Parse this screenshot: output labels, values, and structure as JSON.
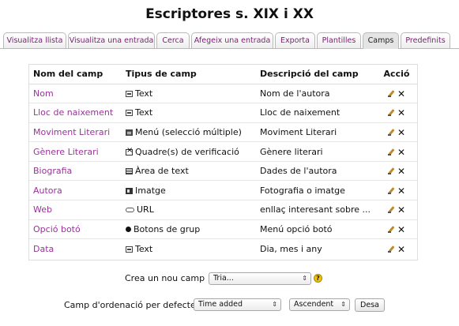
{
  "page": {
    "title": "Escriptores s. XIX i XX"
  },
  "tabs": [
    {
      "label": "Visualitza llista",
      "active": false
    },
    {
      "label": "Visualitza una entrada",
      "active": false
    },
    {
      "label": "Cerca",
      "active": false
    },
    {
      "label": "Afegeix una entrada",
      "active": false
    },
    {
      "label": "Exporta",
      "active": false
    },
    {
      "label": "Plantilles",
      "active": false
    },
    {
      "label": "Camps",
      "active": true
    },
    {
      "label": "Predefinits",
      "active": false
    }
  ],
  "table": {
    "headers": {
      "name": "Nom del camp",
      "type": "Tipus de camp",
      "desc": "Descripció del camp",
      "action": "Acció"
    },
    "rows": [
      {
        "name": "Nom",
        "type": "Text",
        "type_icon": "text-icon",
        "desc": "Nom de l'autora"
      },
      {
        "name": "Lloc de naixement",
        "type": "Text",
        "type_icon": "text-icon",
        "desc": "Lloc de naixement"
      },
      {
        "name": "Moviment Literari",
        "type": "Menú (selecció múltiple)",
        "type_icon": "menu-icon",
        "desc": "Moviment Literari"
      },
      {
        "name": "Gènere Literari",
        "type": "Quadre(s) de verificació",
        "type_icon": "checkbox-icon",
        "desc": "Gènere literari"
      },
      {
        "name": "Biografia",
        "type": "Àrea de text",
        "type_icon": "textarea-icon",
        "desc": "Dades de l'autora"
      },
      {
        "name": "Autora",
        "type": "Imatge",
        "type_icon": "image-icon",
        "desc": "Fotografia o imatge"
      },
      {
        "name": "Web",
        "type": "URL",
        "type_icon": "url-icon",
        "desc": "enllaç interesant sobre ..."
      },
      {
        "name": "Opció botó",
        "type": "Botons de grup",
        "type_icon": "radio-icon",
        "desc": "Menú opció botó"
      },
      {
        "name": "Data",
        "type": "Text",
        "type_icon": "text-icon",
        "desc": "Dia, mes i any"
      }
    ]
  },
  "create_field": {
    "label": "Crea un nou camp",
    "select_value": "Tria..."
  },
  "sort": {
    "label": "Camp d'ordenació per defecte",
    "field_value": "Time added",
    "order_value": "Ascendent",
    "save_label": "Desa"
  },
  "colors": {
    "link": "#993399",
    "tab_text": "#7a1d73",
    "help_icon": "#f2c500"
  }
}
